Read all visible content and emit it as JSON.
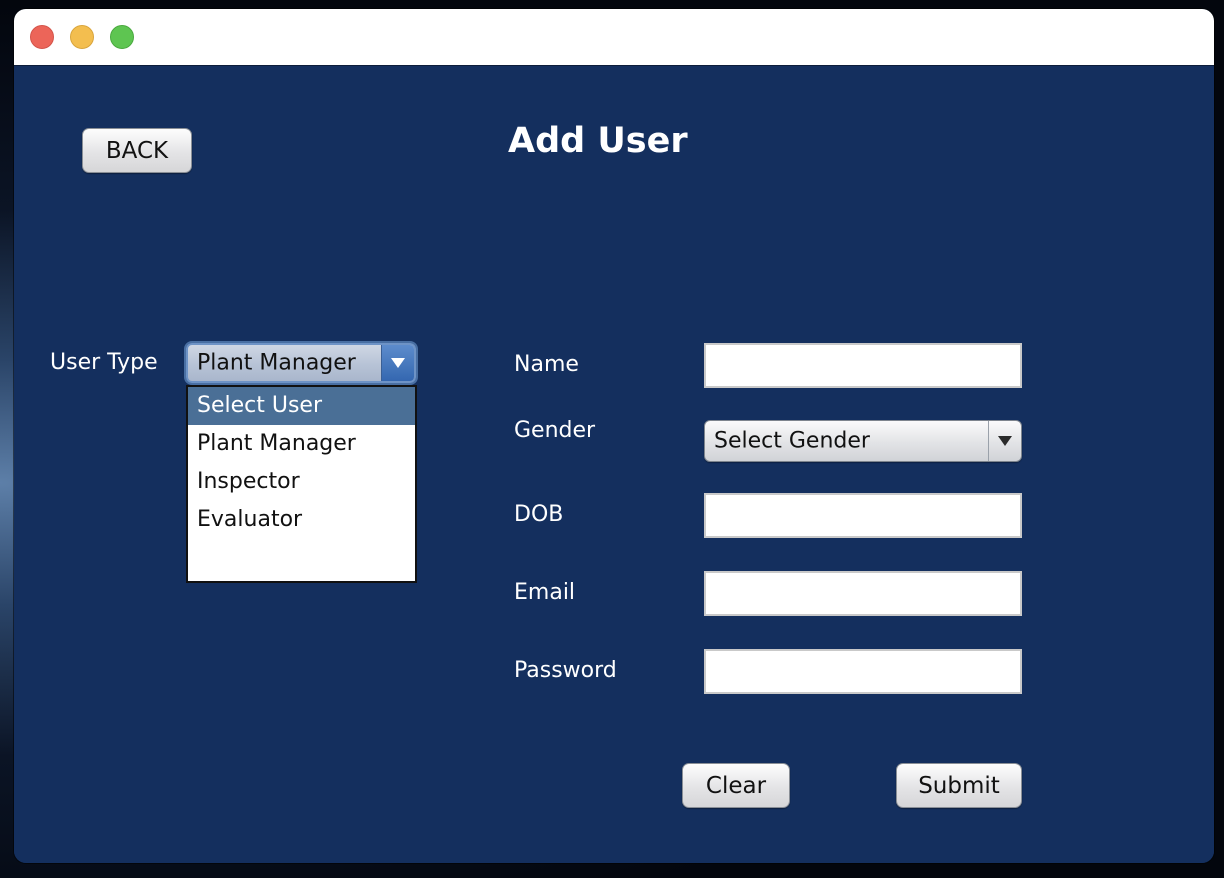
{
  "window": {
    "controls": {
      "close_icon": "close-icon",
      "minimize_icon": "minimize-icon",
      "maximize_icon": "maximize-icon"
    }
  },
  "header": {
    "back_label": "BACK",
    "title": "Add User"
  },
  "user_type": {
    "label": "User Type",
    "selected": "Plant Manager",
    "options": [
      "Select User",
      "Plant Manager",
      "Inspector",
      "Evaluator"
    ],
    "highlighted_option": "Select User",
    "arrow_icon": "chevron-down-icon"
  },
  "form": {
    "name_label": "Name",
    "name_value": "",
    "gender_label": "Gender",
    "gender_selected": "Select Gender",
    "dob_label": "DOB",
    "dob_value": "",
    "email_label": "Email",
    "email_value": "",
    "password_label": "Password",
    "password_value": ""
  },
  "actions": {
    "clear_label": "Clear",
    "submit_label": "Submit"
  },
  "colors": {
    "panel_background": "#142f5e",
    "highlight": "#4a6f96",
    "close": "#ec6559",
    "minimize": "#f3be4f",
    "maximize": "#5ec551"
  }
}
